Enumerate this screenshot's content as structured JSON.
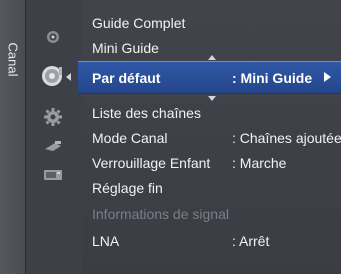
{
  "side_tab": {
    "label": "Canal"
  },
  "menu_top": [
    {
      "label": "Guide Complet",
      "value": ""
    },
    {
      "label": "Mini Guide",
      "value": ""
    }
  ],
  "selected": {
    "label": "Par défaut",
    "value": ": Mini Guide"
  },
  "menu_items": [
    {
      "label": "Liste des chaînes",
      "value": ""
    },
    {
      "label": "Mode Canal",
      "value": ": Chaînes ajoutées"
    },
    {
      "label": "Verrouillage Enfant",
      "value": ": Marche"
    },
    {
      "label": "Réglage fin",
      "value": ""
    },
    {
      "label": "Informations de signal",
      "value": ""
    },
    {
      "label": "LNA",
      "value": ": Arrêt"
    }
  ]
}
